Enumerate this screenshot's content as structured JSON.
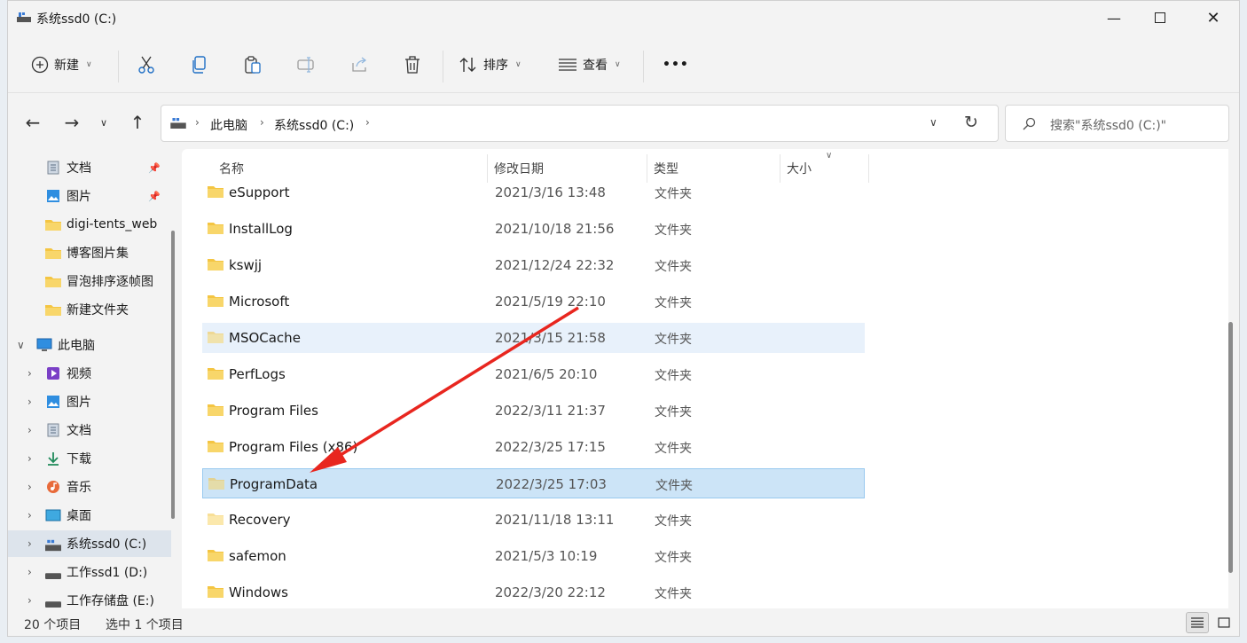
{
  "window": {
    "title": "系统ssd0 (C:)",
    "minimize_icon": "minimize-icon",
    "maximize_icon": "maximize-icon",
    "close_icon": "close-icon"
  },
  "commandbar": {
    "new_label": "新建",
    "sort_label": "排序",
    "view_label": "查看",
    "more_label": "•••",
    "icons": [
      "plus-circle-icon",
      "cut-icon",
      "copy-icon",
      "paste-icon",
      "rename-icon",
      "share-icon",
      "delete-icon",
      "sort-icon",
      "view-icon",
      "more-icon"
    ]
  },
  "address": {
    "segments": [
      "此电脑",
      "系统ssd0 (C:)"
    ],
    "search_placeholder": "搜索\"系统ssd0 (C:)\""
  },
  "sidebar": {
    "pinned": [
      {
        "label": "文档",
        "icon": "document-icon",
        "pinned": true
      },
      {
        "label": "图片",
        "icon": "pictures-icon",
        "pinned": true
      },
      {
        "label": "digi-tents_web",
        "icon": "folder-icon"
      },
      {
        "label": "博客图片集",
        "icon": "folder-icon"
      },
      {
        "label": "冒泡排序逐帧图",
        "icon": "folder-icon"
      },
      {
        "label": "新建文件夹",
        "icon": "folder-icon"
      }
    ],
    "pc_label": "此电脑",
    "pc_children": [
      {
        "label": "视频",
        "icon": "video-icon"
      },
      {
        "label": "图片",
        "icon": "pictures-icon"
      },
      {
        "label": "文档",
        "icon": "document-icon"
      },
      {
        "label": "下载",
        "icon": "download-icon"
      },
      {
        "label": "音乐",
        "icon": "music-icon"
      },
      {
        "label": "桌面",
        "icon": "desktop-icon"
      },
      {
        "label": "系统ssd0 (C:)",
        "icon": "drive-icon",
        "selected": true
      },
      {
        "label": "工作ssd1 (D:)",
        "icon": "drive-icon"
      },
      {
        "label": "工作存储盘 (E:)",
        "icon": "drive-icon"
      }
    ]
  },
  "columns": {
    "name": "名称",
    "date": "修改日期",
    "type": "类型",
    "size": "大小"
  },
  "files": [
    {
      "name": "eSupport",
      "date": "2021/3/16 13:48",
      "type": "文件夹"
    },
    {
      "name": "InstallLog",
      "date": "2021/10/18 21:56",
      "type": "文件夹"
    },
    {
      "name": "kswjj",
      "date": "2021/12/24 22:32",
      "type": "文件夹"
    },
    {
      "name": "Microsoft",
      "date": "2021/5/19 22:10",
      "type": "文件夹"
    },
    {
      "name": "MSOCache",
      "date": "2021/3/15 21:58",
      "type": "文件夹",
      "state": "hover",
      "hidden": true
    },
    {
      "name": "PerfLogs",
      "date": "2021/6/5 20:10",
      "type": "文件夹"
    },
    {
      "name": "Program Files",
      "date": "2022/3/11 21:37",
      "type": "文件夹"
    },
    {
      "name": "Program Files (x86)",
      "date": "2022/3/25 17:15",
      "type": "文件夹"
    },
    {
      "name": "ProgramData",
      "date": "2022/3/25 17:03",
      "type": "文件夹",
      "state": "selected",
      "hidden": true
    },
    {
      "name": "Recovery",
      "date": "2021/11/18 13:11",
      "type": "文件夹",
      "hidden": true
    },
    {
      "name": "safemon",
      "date": "2021/5/3 10:19",
      "type": "文件夹"
    },
    {
      "name": "Windows",
      "date": "2022/3/20 22:12",
      "type": "文件夹"
    }
  ],
  "status": {
    "count": "20 个项目",
    "selected": "选中 1 个项目"
  },
  "colors": {
    "accent": "#cce4f7",
    "annotation_arrow": "#e8261f",
    "folder": "#f4c542"
  }
}
